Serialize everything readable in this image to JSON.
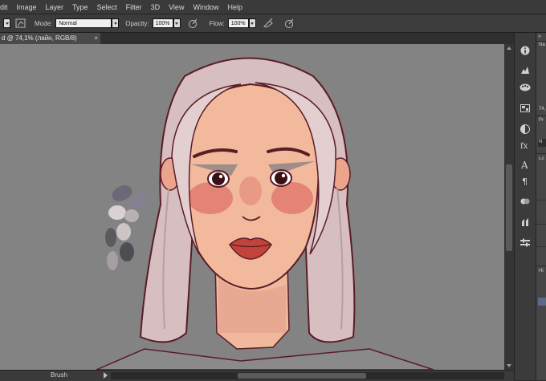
{
  "menu": [
    "Edit",
    "Image",
    "Layer",
    "Type",
    "Select",
    "Filter",
    "3D",
    "View",
    "Window",
    "Help"
  ],
  "menu_first_visible": "dit",
  "options": {
    "mode_label": "Mode:",
    "mode_value": "Normal",
    "opacity_label": "Opacity:",
    "opacity_value": "100%",
    "flow_label": "Flow:",
    "flow_value": "100%"
  },
  "document_tab": {
    "title": "d @ 74,1% (лайн, RGB/8)",
    "close": "×"
  },
  "status": {
    "tool": "Brush"
  },
  "panel": {
    "na": "Na",
    "zoom": "74,",
    "pr": "Pr",
    "n": "N",
    "lo": "Lo",
    "hi": "Hi"
  },
  "palette": [
    "#6d6877",
    "#868090",
    "#d9d2d2",
    "#b9b0b4",
    "#5c5a5f",
    "#a59ea5",
    "#cdc5c5",
    "#4f4d53"
  ],
  "colors": {
    "canvas": "#838383",
    "hair": "#dcc5c6",
    "skin": "#f1b79b",
    "blush": "#d9605a",
    "line": "#5a1c27",
    "lips": "#c2433a"
  }
}
